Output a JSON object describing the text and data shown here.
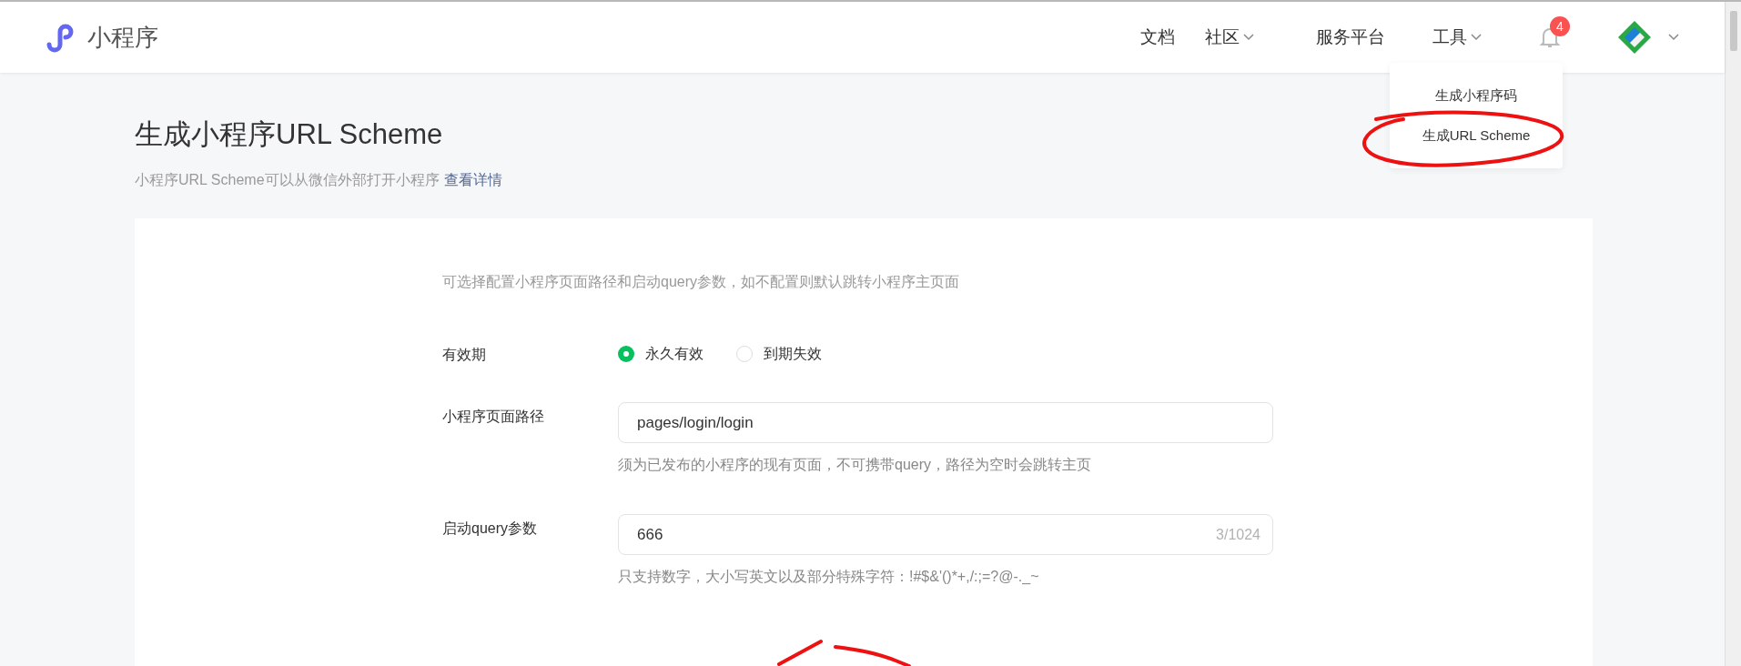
{
  "header": {
    "logo_text": "小程序",
    "nav": [
      {
        "label": "文档",
        "dropdown": false
      },
      {
        "label": "社区",
        "dropdown": true
      },
      {
        "label": "服务平台",
        "dropdown": false
      },
      {
        "label": "工具",
        "dropdown": true
      }
    ],
    "notification_count": "4"
  },
  "tools_menu": {
    "items": [
      {
        "label": "生成小程序码"
      },
      {
        "label": "生成URL Scheme"
      }
    ]
  },
  "page": {
    "title": "生成小程序URL Scheme",
    "subtitle": "小程序URL Scheme可以从微信外部打开小程序",
    "subtitle_link": "查看详情"
  },
  "form": {
    "intro": "可选择配置小程序页面路径和启动query参数，如不配置则默认跳转小程序主页面",
    "validity": {
      "label": "有效期",
      "options": [
        {
          "label": "永久有效",
          "selected": true
        },
        {
          "label": "到期失效",
          "selected": false
        }
      ]
    },
    "path": {
      "label": "小程序页面路径",
      "value": "pages/login/login",
      "help": "须为已发布的小程序的现有页面，不可携带query，路径为空时会跳转主页"
    },
    "query": {
      "label": "启动query参数",
      "value": "666",
      "counter": "3/1024",
      "help": "只支持数字，大小写英文以及部分特殊字符：!#$&'()*+,/:;=?@-._~"
    }
  }
}
